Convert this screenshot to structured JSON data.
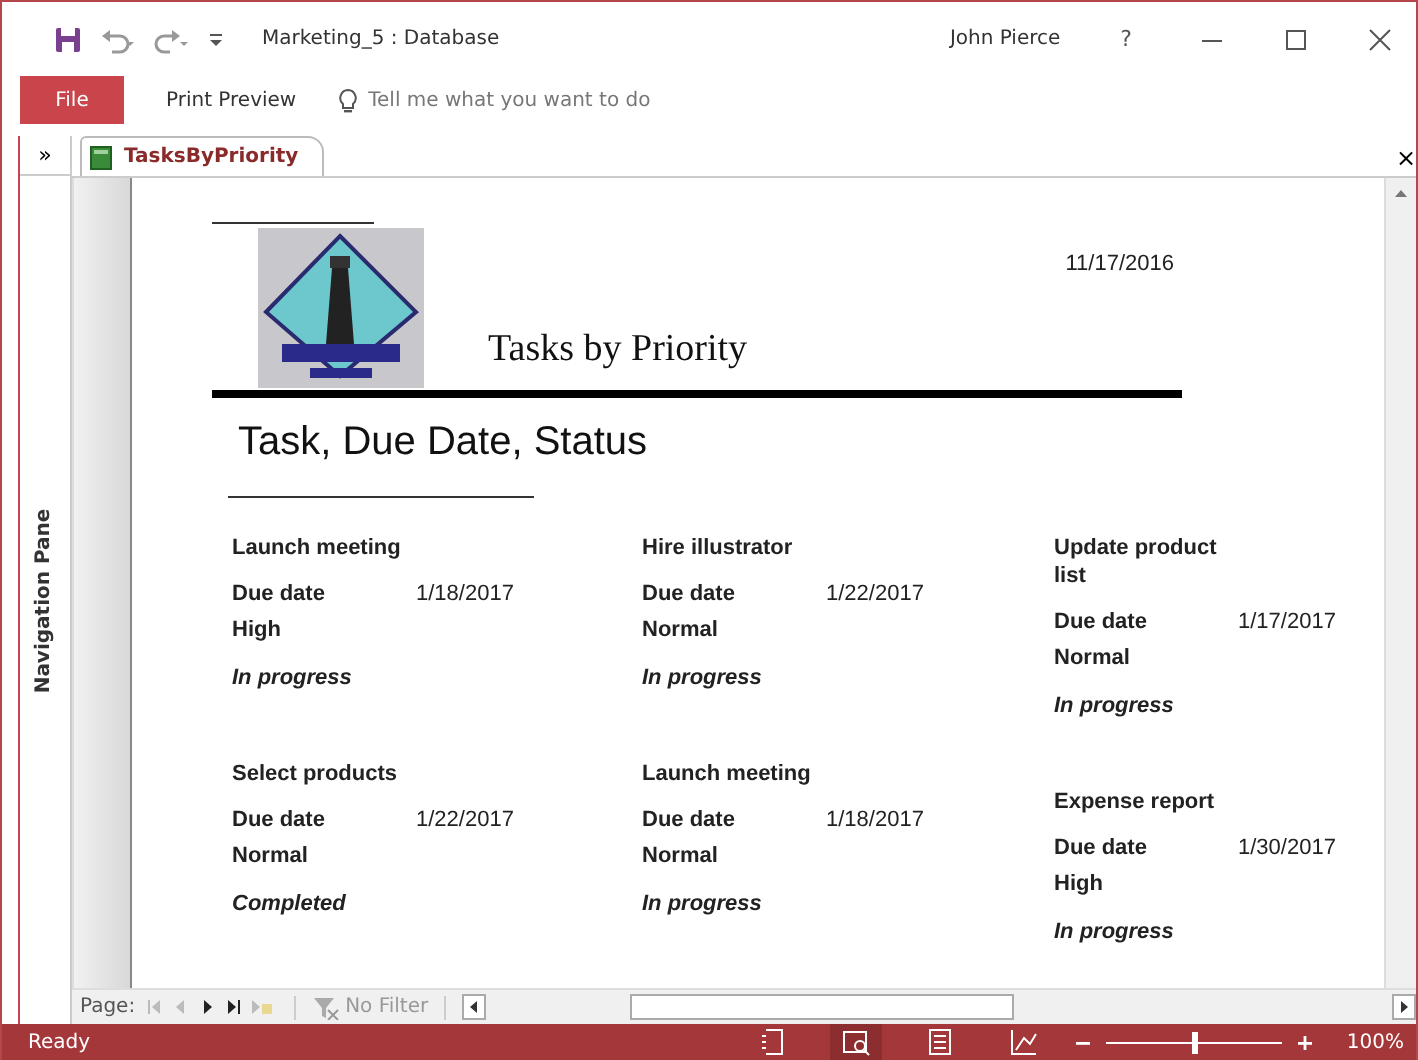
{
  "window": {
    "title": "Marketing_5 : Database",
    "user": "John Pierce",
    "help": "?"
  },
  "ribbon": {
    "tabs": [
      {
        "label": "File",
        "selected": true
      },
      {
        "label": "Print Preview",
        "selected": false
      }
    ],
    "search": {
      "placeholder": "Tell me what you want to do"
    }
  },
  "navigation_pane": {
    "toggle": "»",
    "label": "Navigation Pane"
  },
  "document_tabs": [
    {
      "label": "TasksByPriority",
      "selected": true
    }
  ],
  "document_close": "×",
  "report": {
    "date": "11/17/2016",
    "title": "Tasks by Priority",
    "subtitle": "Task, Due Date, Status",
    "columns": [
      [
        {
          "task": "Launch meeting",
          "due_label": "Due date",
          "due": "1/18/2017",
          "priority": "High",
          "status": "In progress"
        },
        {
          "task": "Select products",
          "due_label": "Due date",
          "due": "1/22/2017",
          "priority": "Normal",
          "status": "Completed"
        }
      ],
      [
        {
          "task": "Hire illustrator",
          "due_label": "Due date",
          "due": "1/22/2017",
          "priority": "Normal",
          "status": "In progress"
        },
        {
          "task": "Launch meeting",
          "due_label": "Due date",
          "due": "1/18/2017",
          "priority": "Normal",
          "status": "In progress"
        }
      ],
      [
        {
          "task": "Update product list",
          "due_label": "Due date",
          "due": "1/17/2017",
          "priority": "Normal",
          "status": "In progress"
        },
        {
          "task": "Expense report",
          "due_label": "Due date",
          "due": "1/30/2017",
          "priority": "High",
          "status": "In progress"
        }
      ]
    ]
  },
  "record_navigator": {
    "label": "Page:",
    "filter": "No Filter"
  },
  "status_bar": {
    "text": "Ready",
    "zoom": {
      "level": 0.5,
      "reading": "100%"
    }
  }
}
